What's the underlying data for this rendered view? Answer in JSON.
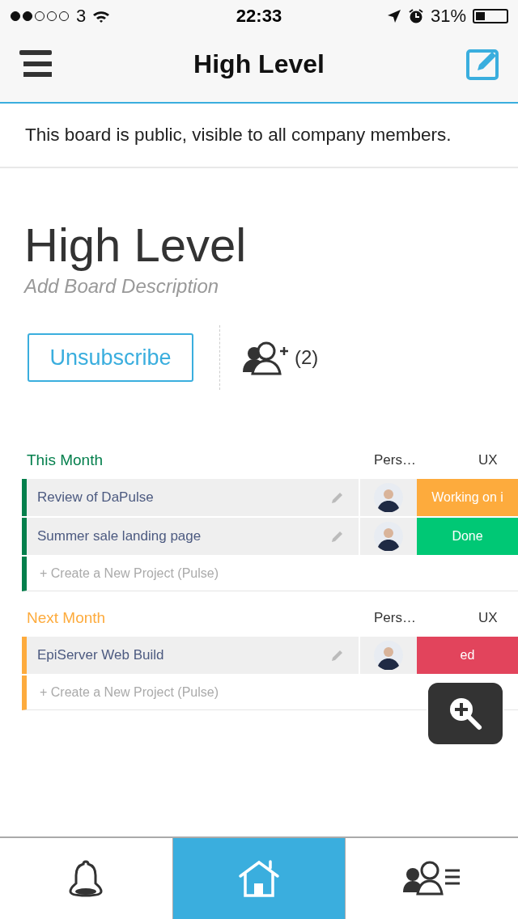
{
  "status_bar": {
    "carrier": "3",
    "time": "22:33",
    "battery": "31%"
  },
  "nav": {
    "title": "High Level"
  },
  "notice": "This board is public, visible to all company members.",
  "board": {
    "title": "High Level",
    "description_placeholder": "Add Board Description",
    "subscribe_button": "Unsubscribe",
    "members_count": "(2)"
  },
  "groups": [
    {
      "title": "This Month",
      "color": "#037f4c",
      "columns": [
        "Pers…",
        "UX"
      ],
      "rows": [
        {
          "name": "Review of DaPulse",
          "status": "Working on i",
          "color": "#fdab3d"
        },
        {
          "name": "Summer sale landing page",
          "status": "Done",
          "color": "#00c875"
        }
      ],
      "add_row": "+ Create a New Project (Pulse)"
    },
    {
      "title": "Next Month",
      "color": "#fdab3d",
      "columns": [
        "Pers…",
        "UX"
      ],
      "rows": [
        {
          "name": "EpiServer Web Build",
          "status": "ed",
          "color": "#e2445c"
        }
      ],
      "add_row": "+ Create a New Project (Pulse)"
    }
  ],
  "tabs": [
    {
      "kind": "notifications",
      "selected": false
    },
    {
      "kind": "home",
      "selected": true
    },
    {
      "kind": "people",
      "selected": false
    }
  ]
}
